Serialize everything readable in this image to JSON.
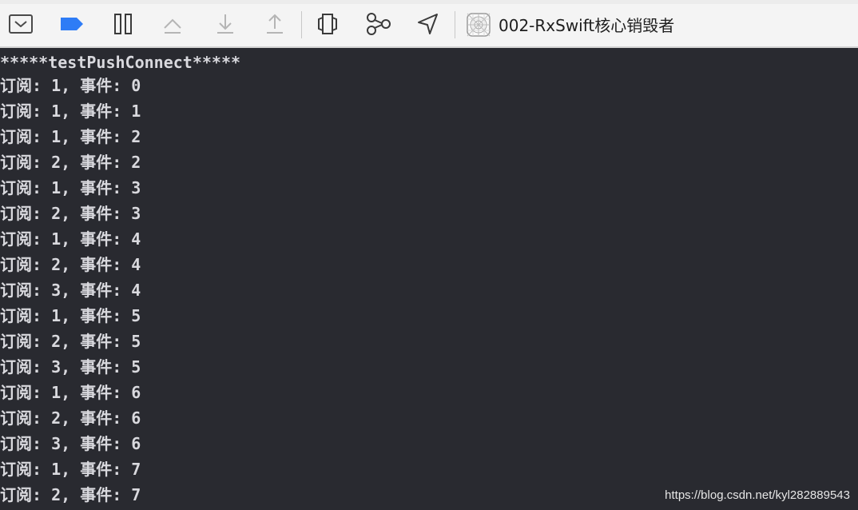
{
  "toolbar": {
    "buttons": [
      {
        "name": "hide-debug-area-button",
        "icon": "debug-area-toggle-icon"
      },
      {
        "name": "breakpoints-toggle-button",
        "icon": "breakpoint-icon"
      },
      {
        "name": "pause-button",
        "icon": "pause-icon"
      },
      {
        "name": "step-over-button",
        "icon": "step-over-icon"
      },
      {
        "name": "step-into-button",
        "icon": "step-into-icon"
      },
      {
        "name": "step-out-button",
        "icon": "step-out-icon"
      },
      {
        "name": "debug-view-hierarchy-button",
        "icon": "view-hierarchy-icon"
      },
      {
        "name": "debug-memory-graph-button",
        "icon": "memory-graph-icon"
      },
      {
        "name": "simulate-location-button",
        "icon": "location-arrow-icon"
      }
    ],
    "scheme_icon": "app-target-icon",
    "scheme_name": "002-RxSwift核心销毁者"
  },
  "colors": {
    "console_background": "#292a30",
    "console_text": "#d9d9de",
    "toolbar_background": "#f4f4f4",
    "breakpoint_accent": "#2e7cf6"
  },
  "console": {
    "lines": [
      "*****testPushConnect*****",
      "订阅: 1, 事件: 0",
      "订阅: 1, 事件: 1",
      "订阅: 1, 事件: 2",
      "订阅: 2, 事件: 2",
      "订阅: 1, 事件: 3",
      "订阅: 2, 事件: 3",
      "订阅: 1, 事件: 4",
      "订阅: 2, 事件: 4",
      "订阅: 3, 事件: 4",
      "订阅: 1, 事件: 5",
      "订阅: 2, 事件: 5",
      "订阅: 3, 事件: 5",
      "订阅: 1, 事件: 6",
      "订阅: 2, 事件: 6",
      "订阅: 3, 事件: 6",
      "订阅: 1, 事件: 7",
      "订阅: 2, 事件: 7"
    ]
  },
  "watermark": "https://blog.csdn.net/kyl282889543"
}
